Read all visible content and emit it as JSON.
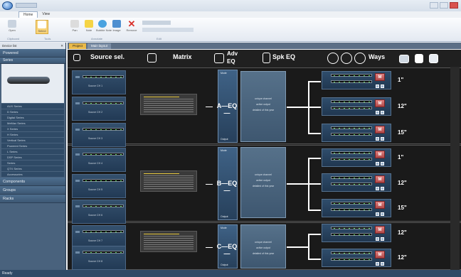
{
  "window": {
    "tabs": [
      "Home",
      "View"
    ]
  },
  "ribbon": {
    "buttons": [
      "Open",
      "Select",
      "Pan",
      "Note",
      "Bubble Note",
      "Image",
      "Remove"
    ],
    "groups": [
      "Clipboard",
      "Tools",
      "Annotate",
      "Edit"
    ]
  },
  "document": {
    "tabs": [
      "Project",
      "Main layout"
    ]
  },
  "leftpanel": {
    "title": "Device list",
    "sections_top": [
      "Powered",
      "Series"
    ],
    "items": [
      "AUX Series",
      "D Series",
      "Digital Series",
      "MeMax Series",
      "X Series",
      "H Series",
      "Vertical Series",
      "Powered Series",
      "L Series",
      "DSP Series",
      "Series",
      "QTX Series",
      "Accessories"
    ],
    "sections_bottom": [
      "Components",
      "Groups",
      "Racks"
    ]
  },
  "main": {
    "source_label": "Source sel.",
    "matrix_label": "Matrix",
    "adv_label": "Adv",
    "adv_label2": "EQ",
    "spk_label": "Spk EQ",
    "ways_label": "Ways",
    "sources": [
      "Source CH 1",
      "Source CH 2",
      "Source CH 3",
      "Source CH 4",
      "Source CH 5",
      "Source CH 6",
      "Source CH 7",
      "Source CH 8"
    ],
    "eq": [
      {
        "label": "A—EQ—",
        "mode": "Mode",
        "out": "Output"
      },
      {
        "label": "B—EQ—",
        "mode": "Mode",
        "out": "Output"
      },
      {
        "label": "C—EQ—",
        "mode": "Mode",
        "out": "Output"
      }
    ],
    "info_lines": [
      "unique channel",
      "active output",
      "detailed of this year"
    ],
    "way_sizes": [
      "1\"",
      "12\"",
      "15\"",
      "1\"",
      "12\"",
      "15\"",
      "12\"",
      "12\""
    ],
    "way_button": "M"
  },
  "status": {
    "text": "Ready"
  }
}
